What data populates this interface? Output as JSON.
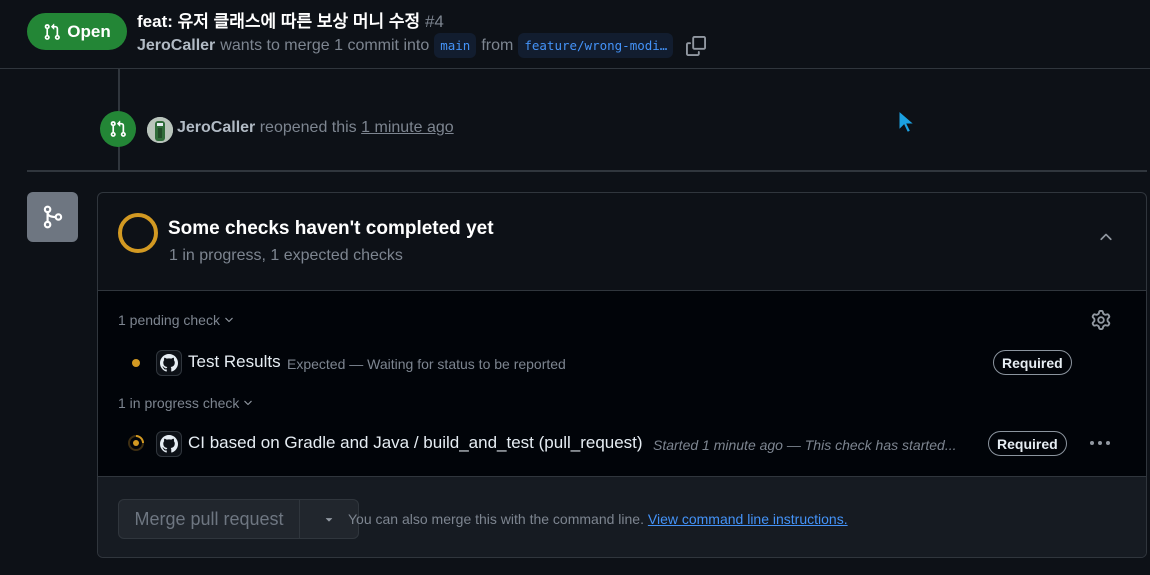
{
  "header": {
    "state_badge": "Open",
    "title": "feat: 유저 클래스에 따른 보상 머니 수정",
    "number": "#4",
    "author": "JeroCaller",
    "merge_text": "wants to merge 1 commit into",
    "base_branch": "main",
    "from_text": "from",
    "head_branch": "feature/wrong-modi…"
  },
  "timeline": {
    "event_author": "JeroCaller",
    "event_text": "reopened this",
    "event_time": "1 minute ago"
  },
  "checks": {
    "title": "Some checks haven't completed yet",
    "subtitle": "1 in progress, 1 expected checks",
    "pending_group": "1 pending check",
    "pending_items": [
      {
        "name": "Test Results",
        "description": "Expected — Waiting for status to be reported",
        "badge": "Required"
      }
    ],
    "progress_group": "1 in progress check",
    "progress_items": [
      {
        "name": "CI based on Gradle and Java / build_and_test (pull_request)",
        "description": "Started 1 minute ago — This check has started...",
        "badge": "Required"
      }
    ]
  },
  "merge": {
    "button_label": "Merge pull request",
    "footer_text": "You can also merge this with the command line.",
    "footer_link": "View command line instructions."
  },
  "colors": {
    "open_green": "#238636",
    "pending_yellow": "#d29922",
    "link_blue": "#4493f8",
    "background": "#0d1117"
  },
  "icons": [
    "git-pull-request-icon",
    "copy-icon",
    "git-merge-icon",
    "chevron-up-icon",
    "chevron-down-icon",
    "gear-icon",
    "github-logo-icon",
    "kebab-menu-icon",
    "mouse-cursor-icon"
  ]
}
